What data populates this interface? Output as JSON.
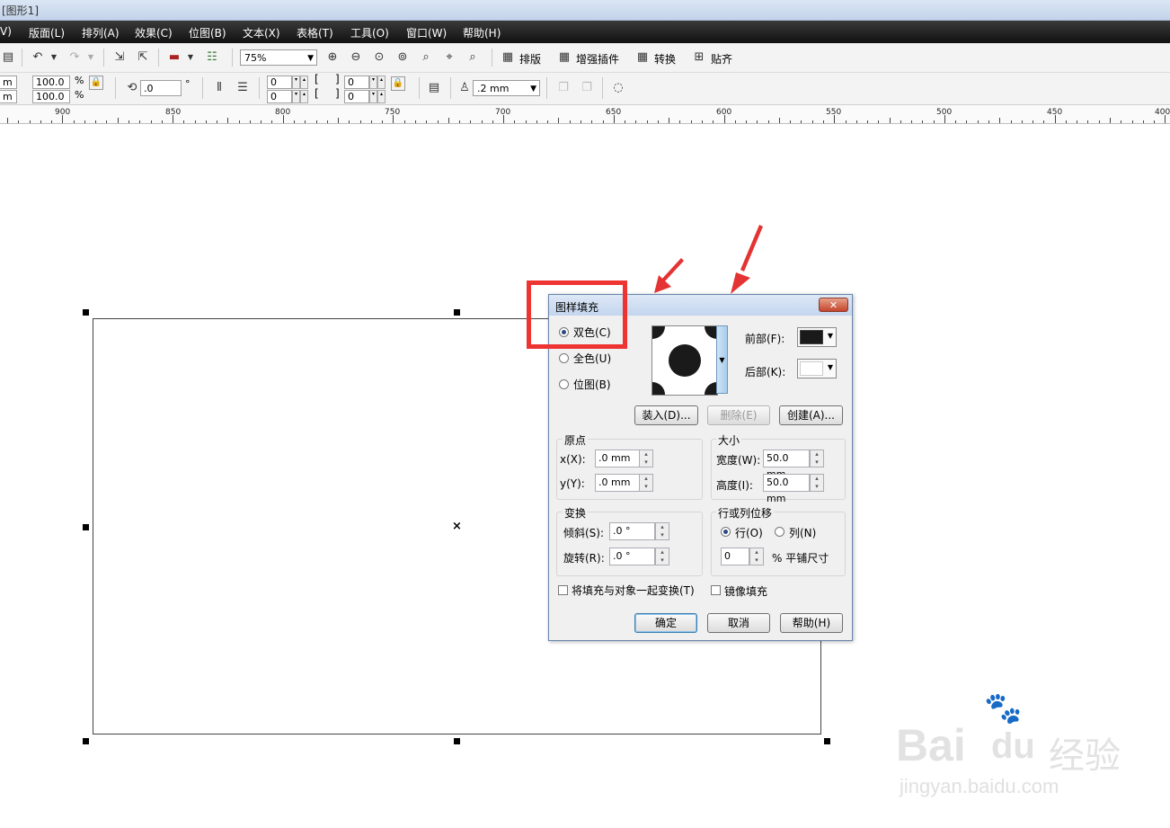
{
  "window": {
    "title": "[图形1]"
  },
  "menu": [
    "V)",
    "版面(L)",
    "排列(A)",
    "效果(C)",
    "位图(B)",
    "文本(X)",
    "表格(T)",
    "工具(O)",
    "窗口(W)",
    "帮助(H)"
  ],
  "toolbar1": {
    "zoom": "75%",
    "buttons": [
      "排版",
      "增强插件",
      "转换",
      "贴齐"
    ]
  },
  "toolbar2": {
    "unit_top": "m",
    "unit_bottom": "m",
    "scale_w": "100.0",
    "scale_h": "100.0",
    "percent": "%",
    "rotation": ".0",
    "degree": "°",
    "pos_a1": "0",
    "pos_a2": "0",
    "pos_b1": "0",
    "pos_b2": "0",
    "outline_width": ".2 mm"
  },
  "ruler": {
    "labels": [
      "900",
      "850",
      "800",
      "750",
      "700",
      "650",
      "600",
      "550",
      "500",
      "450",
      "400"
    ]
  },
  "dialog": {
    "title": "图样填充",
    "close": "✕",
    "radio_two_color": "双色(C)",
    "radio_full_color": "全色(U)",
    "radio_bitmap": "位图(B)",
    "front_label": "前部(F):",
    "back_label": "后部(K):",
    "front_color": "#1a1a1a",
    "back_color": "#ffffff",
    "btn_load": "装入(D)...",
    "btn_delete": "删除(E)",
    "btn_create": "创建(A)...",
    "origin": {
      "title": "原点",
      "x_label": "x(X):",
      "x_value": ".0 mm",
      "y_label": "y(Y):",
      "y_value": ".0 mm"
    },
    "size": {
      "title": "大小",
      "w_label": "宽度(W):",
      "w_value": "50.0 mm",
      "h_label": "高度(I):",
      "h_value": "50.0 mm"
    },
    "transform": {
      "title": "变换",
      "skew_label": "倾斜(S):",
      "skew_value": ".0 °",
      "rotate_label": "旋转(R):",
      "rotate_value": ".0 °"
    },
    "offset": {
      "title": "行或列位移",
      "row": "行(O)",
      "col": "列(N)",
      "value": "0",
      "suffix": "% 平铺尺寸"
    },
    "chk_transform": "将填充与对象一起变换(T)",
    "chk_mirror": "镜像填充",
    "btn_ok": "确定",
    "btn_cancel": "取消",
    "btn_help": "帮助(H)"
  },
  "watermark": {
    "brand": "Bai",
    "paw": "du",
    "cn": "经验",
    "url": "jingyan.baidu.com"
  },
  "colors": {
    "menubar": "#1a1a1a",
    "annotation_red": "#e33333"
  }
}
